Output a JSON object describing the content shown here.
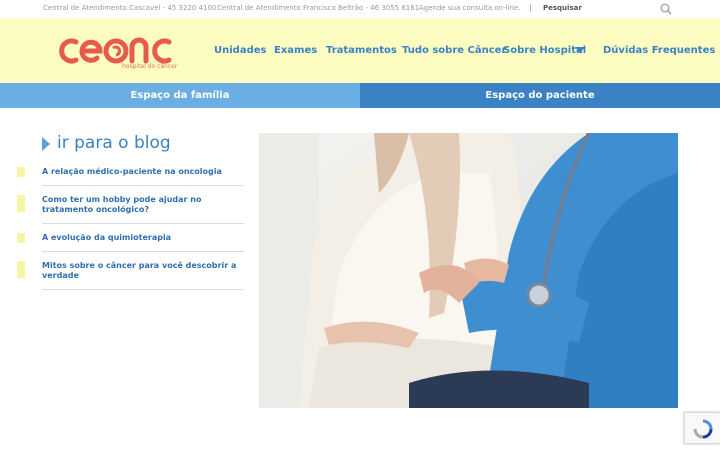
{
  "topbar": {
    "contact_cascavel": "Central de Atendimento Cascavel - 45 3220 4100",
    "contact_beltrao": "Central de Atendimento Francisco Beltrão - 46 3055 6161",
    "appointment": "Agende sua consulta on-line.",
    "separator": "|",
    "search_label": "Pesquisar",
    "search_icon": "search-icon"
  },
  "logo": {
    "name": "ceonc",
    "tagline": "hospital do câncer"
  },
  "nav": {
    "items": [
      {
        "label": "Unidades"
      },
      {
        "label": "Exames"
      },
      {
        "label": "Tratamentos"
      },
      {
        "label": "Tudo sobre Câncer"
      },
      {
        "label": "Sobre Hospital"
      },
      {
        "label": "Dúvidas Frequentes"
      }
    ],
    "dropdown_icon": "caret-down-icon"
  },
  "tabs": {
    "family": "Espaço da família",
    "patient": "Espaço do paciente"
  },
  "blog": {
    "title": "ir para o blog",
    "posts": [
      {
        "title": "A relação médico-paciente na oncologia"
      },
      {
        "title": "Como ter um hobby pode ajudar no tratamento oncológico?"
      },
      {
        "title": "A evolução da quimioterapia"
      },
      {
        "title": "Mitos sobre o câncer para você descobrir a verdade"
      }
    ]
  },
  "colors": {
    "header_bg": "#fdfdc2",
    "brand_red": "#e85a4f",
    "nav_blue": "#3b82c4",
    "tab_light": "#6aaee4",
    "tab_dark": "#3b82c4"
  }
}
